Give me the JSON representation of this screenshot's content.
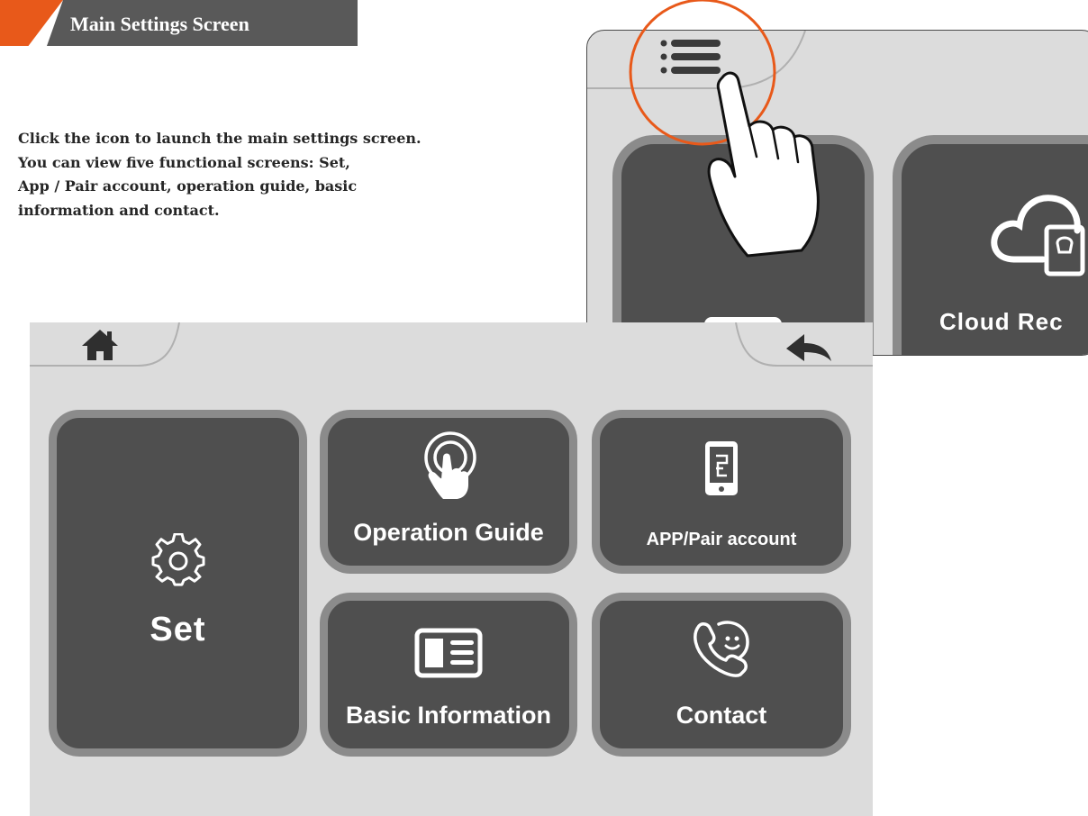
{
  "header": {
    "title": "Main Settings Screen"
  },
  "intro_lines": [
    "Click the icon to launch the main settings screen.",
    "You can view five functional screens: Set,",
    "App / Pair account, operation guide, basic",
    "information and contact."
  ],
  "illustration": {
    "cloud_tile_label": "Cloud Rec"
  },
  "main_screen": {
    "tiles": {
      "set": {
        "label": "Set",
        "icon": "gear-icon"
      },
      "operation_guide": {
        "label": "Operation Guide",
        "icon": "touch-hand-icon"
      },
      "app_pair": {
        "label": "APP/Pair account",
        "icon": "phone-pair-icon"
      },
      "basic_info": {
        "label": "Basic Information",
        "icon": "id-card-icon"
      },
      "contact": {
        "label": "Contact",
        "icon": "contact-phone-icon"
      }
    }
  },
  "colors": {
    "accent": "#e8591a",
    "header": "#595959",
    "tile": "#4f4f4f",
    "tile_border": "#8b8b8b",
    "screen": "#dcdcdc"
  }
}
